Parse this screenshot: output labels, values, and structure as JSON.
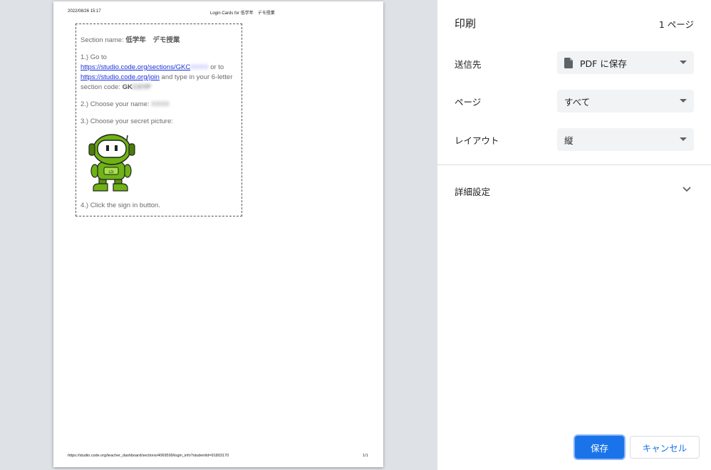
{
  "preview": {
    "header_date": "2022/08/26 15:17",
    "header_title": "Login Cards for 低学年　デモ授業",
    "footer_url": "https://studio.code.org/teacher_dashboard/sections/4069599/login_info?studentId=91803170",
    "footer_page": "1/1",
    "card": {
      "section_label": "Section name: ",
      "section_name": "低学年　デモ授業",
      "step1_prefix": "1.) Go to",
      "link1_text": "https://studio.code.org/sections/GKC",
      "link1_blur": "XXXX",
      "or_to": " or to",
      "link2_text": "https://studio.code.org/join",
      "step1_suffix": " and type in your 6-letter section code: ",
      "code_prefix": "GK",
      "code_blur": "CXYP",
      "step2_label": "2.) Choose your name: ",
      "name_blur": "XXXX",
      "step3_label": "3.) Choose your secret picture:",
      "step4_label": "4.) Click the sign in button."
    }
  },
  "panel": {
    "title": "印刷",
    "page_count": "1 ページ",
    "destination_label": "送信先",
    "destination_value": "PDF に保存",
    "pages_label": "ページ",
    "pages_value": "すべて",
    "layout_label": "レイアウト",
    "layout_value": "縦",
    "more_settings": "詳細設定",
    "save_label": "保存",
    "cancel_label": "キャンセル"
  },
  "colors": {
    "accent": "#1a73e8",
    "select_bg": "#f1f3f4",
    "link": "#1a33d8"
  }
}
